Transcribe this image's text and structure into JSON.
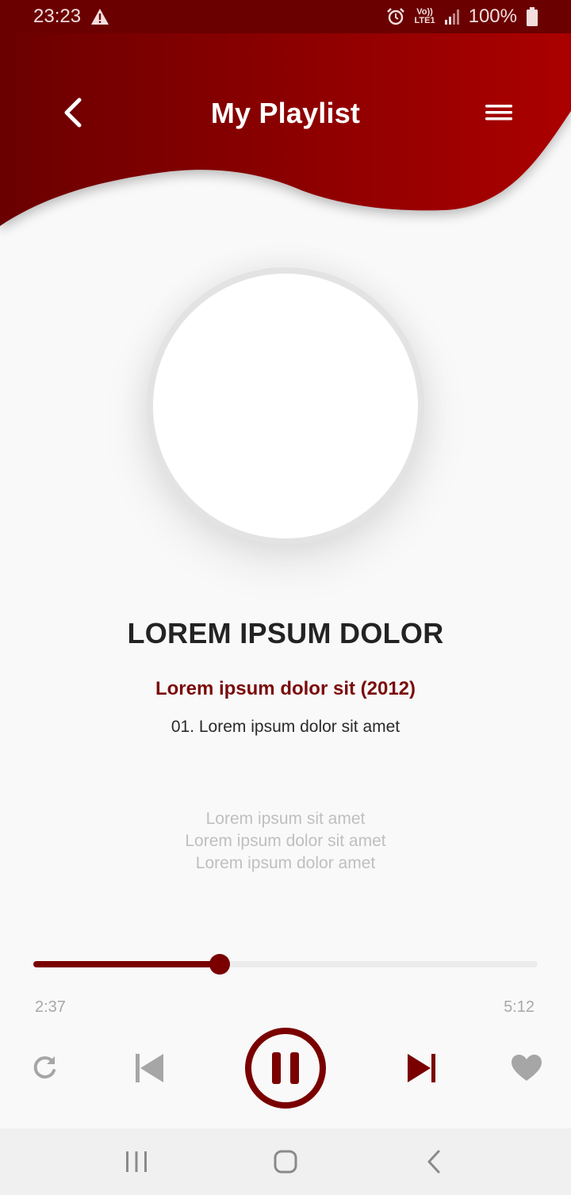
{
  "status_bar": {
    "time": "23:23",
    "network_top": "Vo))",
    "network_bottom": "LTE1",
    "battery": "100%"
  },
  "header": {
    "title": "My Playlist",
    "back_icon": "chevron-left-icon",
    "menu_icon": "hamburger-menu-icon"
  },
  "track": {
    "title": "LOREM IPSUM DOLOR",
    "album": "Lorem ipsum dolor sit (2012)",
    "track_line": "01. Lorem ipsum dolor sit amet",
    "lyrics": [
      "Lorem ipsum sit amet",
      "Lorem ipsum dolor sit amet",
      "Lorem ipsum dolor amet"
    ]
  },
  "player": {
    "current_time": "2:37",
    "total_time": "5:12",
    "progress_fraction": 0.37,
    "is_playing": true
  },
  "colors": {
    "accent": "#7a0000",
    "header_dark": "#6b0000",
    "header_light": "#a80606",
    "muted": "#a8a8a8"
  },
  "icons": {
    "repeat": "repeat-icon",
    "previous": "skip-previous-icon",
    "pause": "pause-icon",
    "next": "skip-next-icon",
    "favorite": "heart-icon",
    "alarm": "alarm-icon",
    "warning": "warning-icon",
    "signal": "signal-icon",
    "battery": "battery-icon"
  }
}
